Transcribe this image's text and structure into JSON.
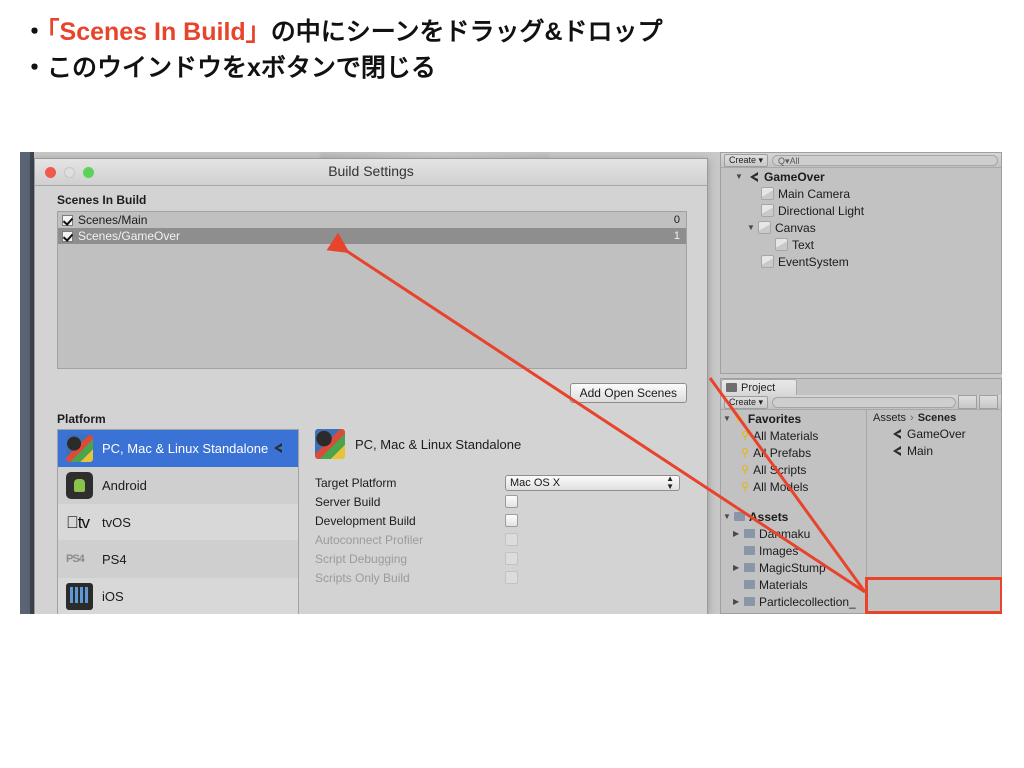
{
  "slide": {
    "bullets": [
      {
        "marker": "・",
        "accent": "「Scenes In Build」",
        "rest": "の中にシーンをドラッグ&ドロップ"
      },
      {
        "marker": "・",
        "accent": "",
        "rest": "このウインドウをxボタンで閉じる"
      }
    ]
  },
  "colors": {
    "accent_red": "#e8432b",
    "selection_blue": "#3b72d6",
    "panel_gray": "#c2c2c2"
  },
  "dialog": {
    "title": "Build Settings",
    "traffic_lights": [
      "close",
      "minimize",
      "zoom"
    ],
    "scenes_in_build": {
      "label": "Scenes In Build",
      "rows": [
        {
          "checked": true,
          "name": "Scenes/Main",
          "index": "0",
          "selected": false
        },
        {
          "checked": true,
          "name": "Scenes/GameOver",
          "index": "1",
          "selected": true
        }
      ]
    },
    "add_open_scenes_label": "Add Open Scenes",
    "platform": {
      "label": "Platform",
      "items": [
        {
          "name": "PC, Mac & Linux Standalone",
          "icon": "standalone-icon",
          "selected": true
        },
        {
          "name": "Android",
          "icon": "android-icon",
          "selected": false
        },
        {
          "name": "tvOS",
          "icon": "appletv-icon",
          "selected": false
        },
        {
          "name": "PS4",
          "icon": "ps4-icon",
          "selected": false
        },
        {
          "name": "iOS",
          "icon": "ios-icon",
          "selected": false
        }
      ]
    },
    "settings": {
      "title": "PC, Mac & Linux Standalone",
      "target_platform_label": "Target Platform",
      "target_platform_value": "Mac OS X",
      "checkboxes": [
        {
          "label": "Server Build",
          "checked": false,
          "disabled": false
        },
        {
          "label": "Development Build",
          "checked": false,
          "disabled": false
        },
        {
          "label": "Autoconnect Profiler",
          "checked": false,
          "disabled": true
        },
        {
          "label": "Script Debugging",
          "checked": false,
          "disabled": true
        },
        {
          "label": "Scripts Only Build",
          "checked": false,
          "disabled": true
        }
      ]
    }
  },
  "hierarchy": {
    "create_label": "Create",
    "search_placeholder": "Q▾All",
    "rows": [
      {
        "label": "GameOver",
        "depth": 0,
        "icon": "unity-scene-icon",
        "expanded": true,
        "bold": true
      },
      {
        "label": "Main Camera",
        "depth": 1,
        "icon": "cube-icon",
        "expanded": null,
        "bold": false
      },
      {
        "label": "Directional Light",
        "depth": 1,
        "icon": "cube-icon",
        "expanded": null,
        "bold": false
      },
      {
        "label": "Canvas",
        "depth": 1,
        "icon": "cube-icon",
        "expanded": true,
        "bold": false
      },
      {
        "label": "Text",
        "depth": 2,
        "icon": "cube-icon",
        "expanded": null,
        "bold": false
      },
      {
        "label": "EventSystem",
        "depth": 1,
        "icon": "cube-icon",
        "expanded": null,
        "bold": false
      }
    ]
  },
  "project": {
    "tab_label": "Project",
    "create_label": "Create",
    "search_placeholder": "",
    "favorites": {
      "label": "Favorites",
      "items": [
        "All Materials",
        "All Prefabs",
        "All Scripts",
        "All Models"
      ]
    },
    "assets": {
      "label": "Assets",
      "items": [
        {
          "label": "Danmaku",
          "expandable": true
        },
        {
          "label": "Images",
          "expandable": false
        },
        {
          "label": "MagicStump",
          "expandable": true
        },
        {
          "label": "Materials",
          "expandable": false
        },
        {
          "label": "Particlecollection_",
          "expandable": true
        }
      ]
    },
    "breadcrumb": {
      "root": "Assets",
      "sep": "›",
      "current": "Scenes"
    },
    "files": [
      {
        "label": "GameOver",
        "icon": "unity-scene-icon"
      },
      {
        "label": "Main",
        "icon": "unity-scene-icon"
      }
    ]
  }
}
